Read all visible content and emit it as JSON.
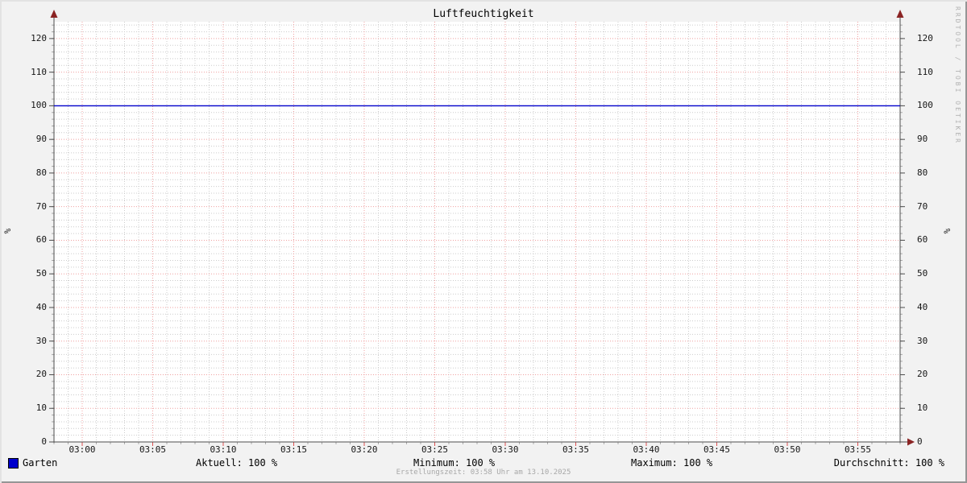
{
  "title": "Luftfeuchtigkeit",
  "watermark": "RRDTOOL / TOBI OETIKER",
  "footer": {
    "creation_text": "Erstellungszeit: 03:58 Uhr am 13.10.2025"
  },
  "legend": {
    "series": {
      "label": "Garten",
      "color": "#0000cc"
    },
    "stats": [
      {
        "label": "Aktuell: 100 %"
      },
      {
        "label": "Minimum: 100 %"
      },
      {
        "label": "Maximum: 100 %"
      },
      {
        "label": "Durchschnitt: 100 %"
      }
    ]
  },
  "chart_data": {
    "type": "line",
    "title": "Luftfeuchtigkeit",
    "ylabel": "%",
    "ylabel_right": "%",
    "ylim": [
      0,
      125
    ],
    "y_ticks": [
      0,
      10,
      20,
      30,
      40,
      50,
      60,
      70,
      80,
      90,
      100,
      110,
      120
    ],
    "y_minor_step": 2,
    "x_start": "02:58",
    "x_end": "03:58",
    "x_minor_step_min": 1,
    "x_major_step_min": 5,
    "x_tick_labels": [
      "03:00",
      "03:05",
      "03:10",
      "03:15",
      "03:20",
      "03:25",
      "03:30",
      "03:35",
      "03:40",
      "03:45",
      "03:50",
      "03:55"
    ],
    "grid": true,
    "legend_position": "bottom",
    "series": [
      {
        "name": "Garten",
        "color": "#0000cc",
        "x": [
          "02:58",
          "03:58"
        ],
        "values": [
          100,
          100
        ]
      }
    ],
    "stats": {
      "aktuell": "100 %",
      "minimum": "100 %",
      "maximum": "100 %",
      "durchschnitt": "100 %"
    }
  },
  "colors": {
    "background": "#f2f2f2",
    "canvas": "#ffffff",
    "grid_minor": "#cccccc",
    "grid_major": "#f0a0a0",
    "axis": "#4d4d4d",
    "arrow": "#8b2424",
    "tick_minor": "#aaaaaa",
    "tick_major_x": "#e05050",
    "text": "#000000",
    "muted_text": "#a8a8a8"
  }
}
